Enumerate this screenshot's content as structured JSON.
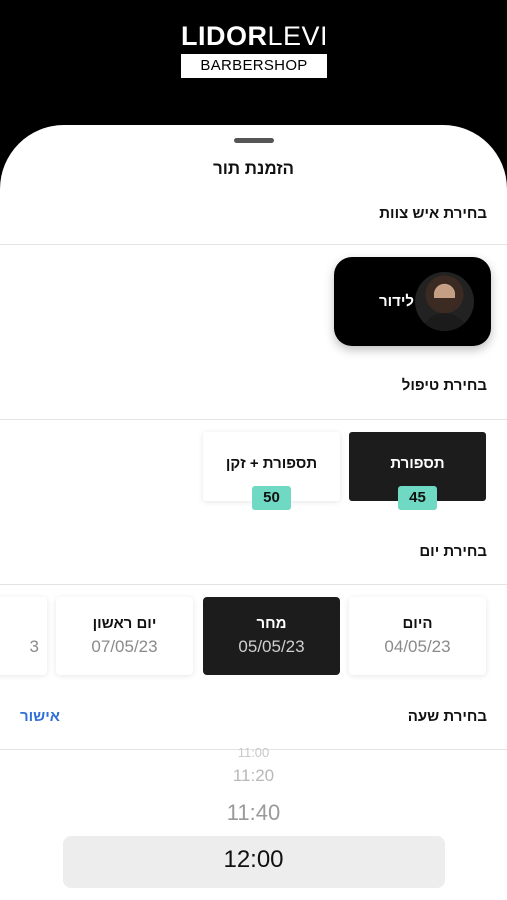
{
  "brand": {
    "name_bold": "LIDOR",
    "name_light": "LEVI",
    "tagline": "BARBERSHOP"
  },
  "sheet": {
    "title": "הזמנת תור"
  },
  "staff_section": {
    "label": "בחירת איש צוות",
    "staff": [
      {
        "name": "לידור",
        "selected": true
      }
    ]
  },
  "service_section": {
    "label": "בחירת טיפול",
    "services": [
      {
        "name": "תספורת",
        "price": "45",
        "selected": true
      },
      {
        "name": "תספורת + זקן",
        "price": "50",
        "selected": false
      }
    ]
  },
  "day_section": {
    "label": "בחירת יום",
    "days": [
      {
        "name": "היום",
        "date": "04/05/23",
        "selected": false
      },
      {
        "name": "מחר",
        "date": "05/05/23",
        "selected": true
      },
      {
        "name": "יום ראשון",
        "date": "07/05/23",
        "selected": false
      },
      {
        "name": "",
        "date": "3",
        "selected": false
      }
    ]
  },
  "time_section": {
    "label": "בחירת שעה",
    "confirm_label": "אישור",
    "times": [
      "11:00",
      "11:20",
      "11:40",
      "12:00"
    ],
    "selected_time": "12:00"
  },
  "colors": {
    "accent_price": "#6fd9c3",
    "confirm": "#2f6fd6",
    "selected_bg": "#1c1c1c"
  }
}
